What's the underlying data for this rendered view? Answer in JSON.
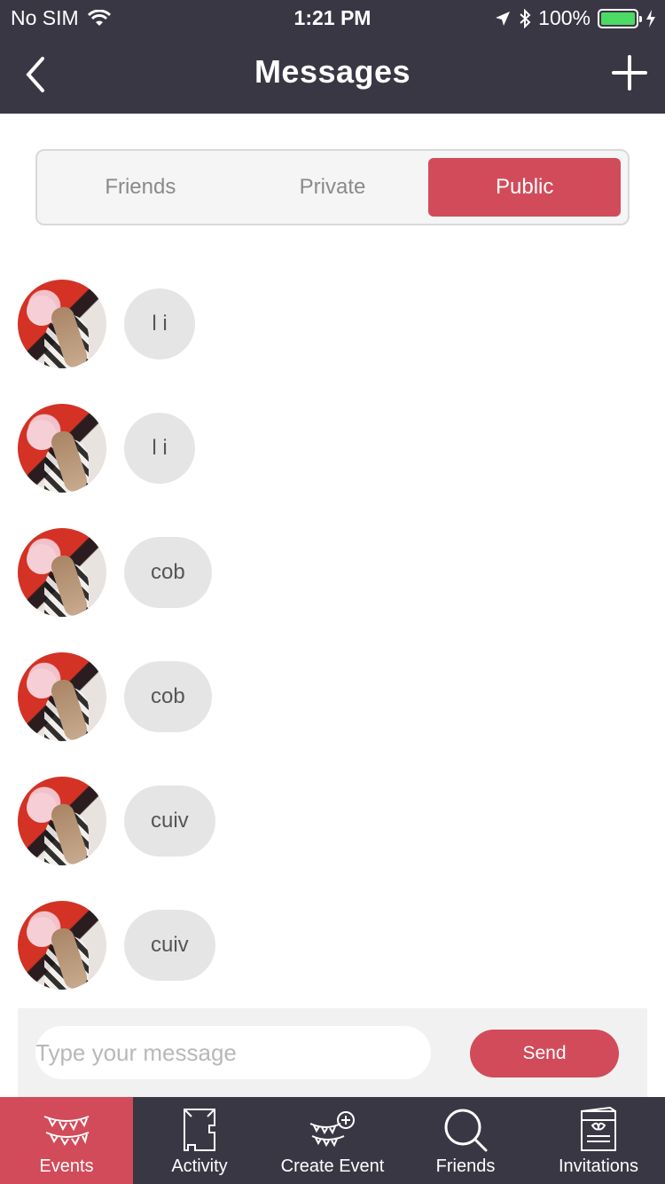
{
  "status_bar": {
    "carrier": "No SIM",
    "time": "1:21 PM",
    "battery": "100%"
  },
  "header": {
    "title": "Messages"
  },
  "segments": [
    {
      "label": "Friends",
      "active": false
    },
    {
      "label": "Private",
      "active": false
    },
    {
      "label": "Public",
      "active": true
    }
  ],
  "messages": [
    {
      "text": "l i"
    },
    {
      "text": "l i"
    },
    {
      "text": "cob"
    },
    {
      "text": "cob"
    },
    {
      "text": "cuiv"
    },
    {
      "text": "cuiv"
    }
  ],
  "composer": {
    "placeholder": "Type your message",
    "send_label": "Send"
  },
  "tabbar": [
    {
      "label": "Events",
      "icon": "bunting-icon",
      "active": true
    },
    {
      "label": "Activity",
      "icon": "activity-icon",
      "active": false
    },
    {
      "label": "Create Event",
      "icon": "create-event-icon",
      "active": false
    },
    {
      "label": "Friends",
      "icon": "search-icon",
      "active": false
    },
    {
      "label": "Invitations",
      "icon": "invitation-card-icon",
      "active": false
    }
  ],
  "colors": {
    "accent": "#d24b5a",
    "header_bg": "#3a3745",
    "bubble_bg": "#e5e5e5",
    "battery_fill": "#4cd964"
  }
}
